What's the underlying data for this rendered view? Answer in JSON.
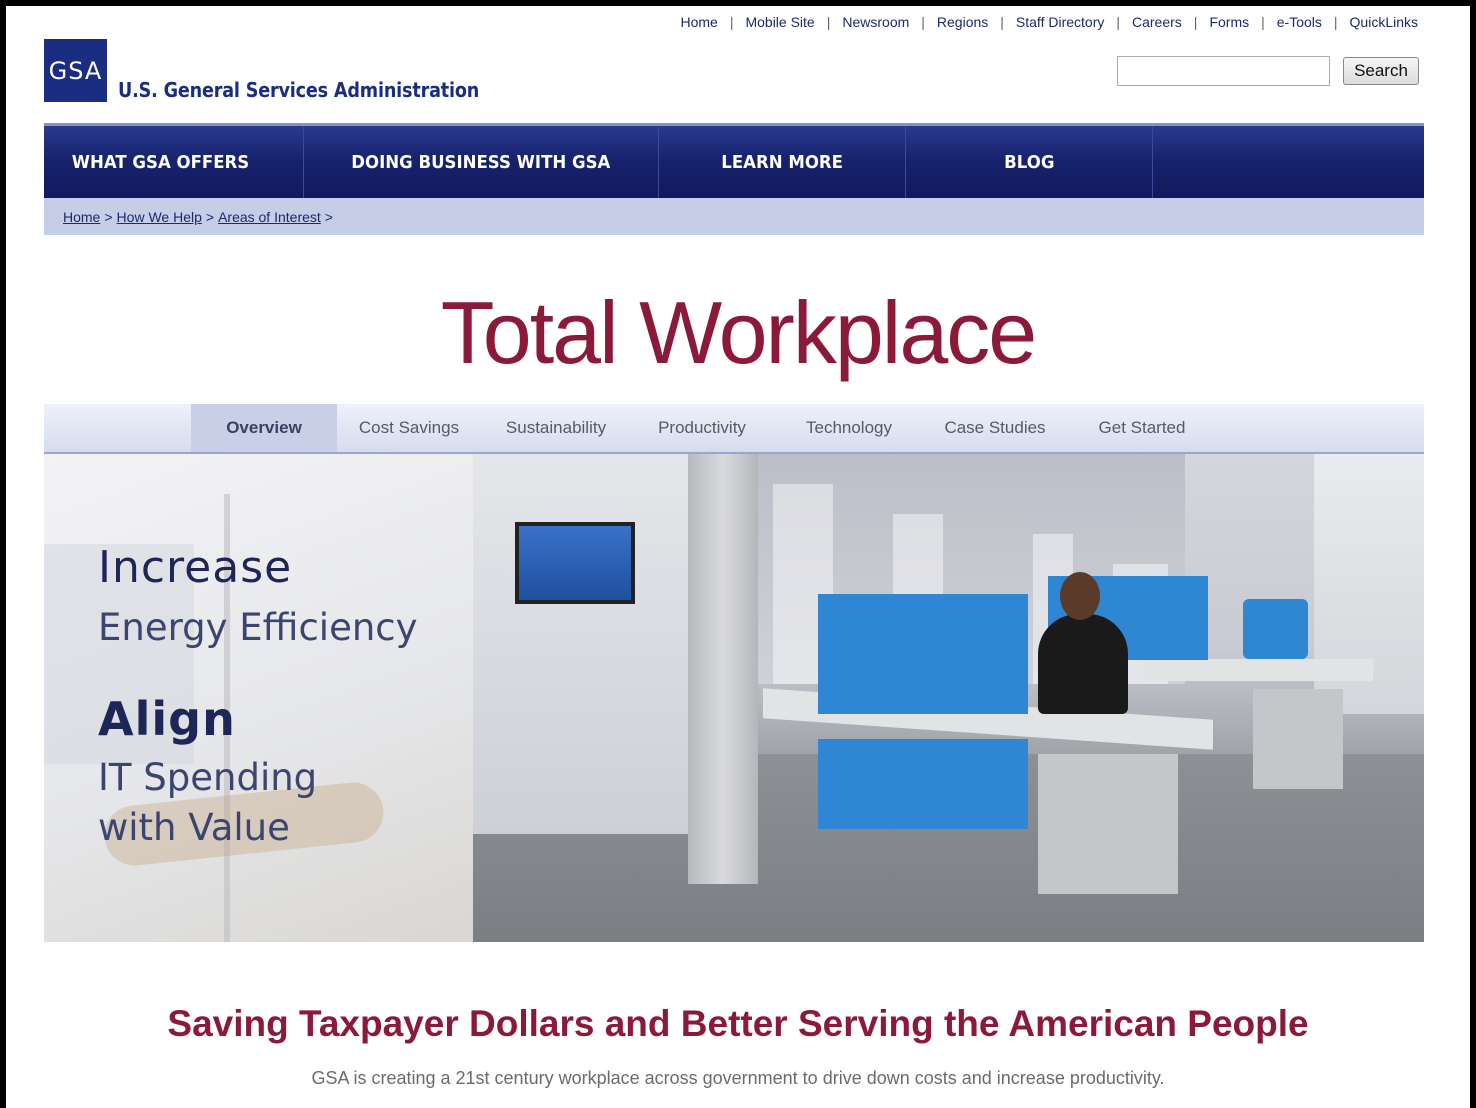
{
  "utility_links": [
    "Home",
    "Mobile Site",
    "Newsroom",
    "Regions",
    "Staff Directory",
    "Careers",
    "Forms",
    "e-Tools",
    "QuickLinks"
  ],
  "logo": {
    "mark": "GSA",
    "name": "U.S. General Services Administration"
  },
  "search": {
    "value": "",
    "button_label": "Search"
  },
  "main_nav": [
    "WHAT GSA OFFERS",
    "DOING BUSINESS WITH GSA",
    "LEARN MORE",
    "BLOG"
  ],
  "breadcrumb": [
    "Home",
    "How We Help",
    "Areas of Interest"
  ],
  "page_title": "Total Workplace",
  "sub_tabs": {
    "items": [
      "Overview",
      "Cost Savings",
      "Sustainability",
      "Productivity",
      "Technology",
      "Case Studies",
      "Get Started"
    ],
    "active": "Overview"
  },
  "hero": {
    "line1_heading": "Increase",
    "line1_sub": "Energy Efficiency",
    "line2_heading": "Align",
    "line2_sub_a": "IT Spending",
    "line2_sub_b": "with Value"
  },
  "section": {
    "heading": "Saving Taxpayer Dollars and Better Serving the American People",
    "subtext": "GSA is creating a 21st century workplace across government to drive down costs and increase productivity."
  },
  "colors": {
    "brand_navy": "#1b2d80",
    "title_maroon": "#8b1a3a",
    "breadcrumb_bg": "#c5cee6"
  }
}
